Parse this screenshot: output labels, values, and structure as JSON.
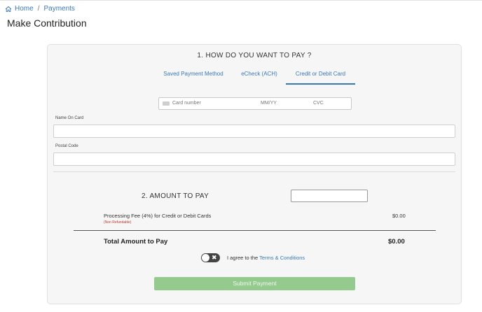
{
  "breadcrumb": {
    "home": "Home",
    "separator": "/",
    "current": "Payments"
  },
  "page": {
    "title": "Make Contribution"
  },
  "section1": {
    "title": "1. HOW DO YOU WANT TO PAY ?",
    "tabs": [
      {
        "label": "Saved Payment Method",
        "active": false
      },
      {
        "label": "eCheck (ACH)",
        "active": false
      },
      {
        "label": "Credit or Debit Card",
        "active": true
      }
    ]
  },
  "card_input": {
    "number_placeholder": "Card number",
    "expiry_placeholder": "MM/YY",
    "cvc_placeholder": "CVC"
  },
  "fields": {
    "name_on_card_label": "Name On Card",
    "name_on_card_value": "",
    "postal_code_label": "Postal Code",
    "postal_code_value": ""
  },
  "section2": {
    "title": "2. AMOUNT TO PAY",
    "amount_value": "",
    "fee_label": "Processing Fee (4%) for Credit or Debit Cards",
    "fee_note": "(Non Refundable)",
    "fee_value": "$0.00",
    "total_label": "Total Amount to Pay",
    "total_value": "$0.00"
  },
  "agreement": {
    "prefix": "I agree to the ",
    "link": "Terms & Conditions",
    "checked": false
  },
  "submit_label": "Submit Payment",
  "colors": {
    "link": "#3b78b4",
    "submit_bg": "#95ca8f",
    "toggle_bg": "#444444",
    "nonrefundable": "#c0392b"
  },
  "icons": {
    "home": "home-icon",
    "card": "credit-card-icon",
    "toggle_off": "close-icon"
  }
}
